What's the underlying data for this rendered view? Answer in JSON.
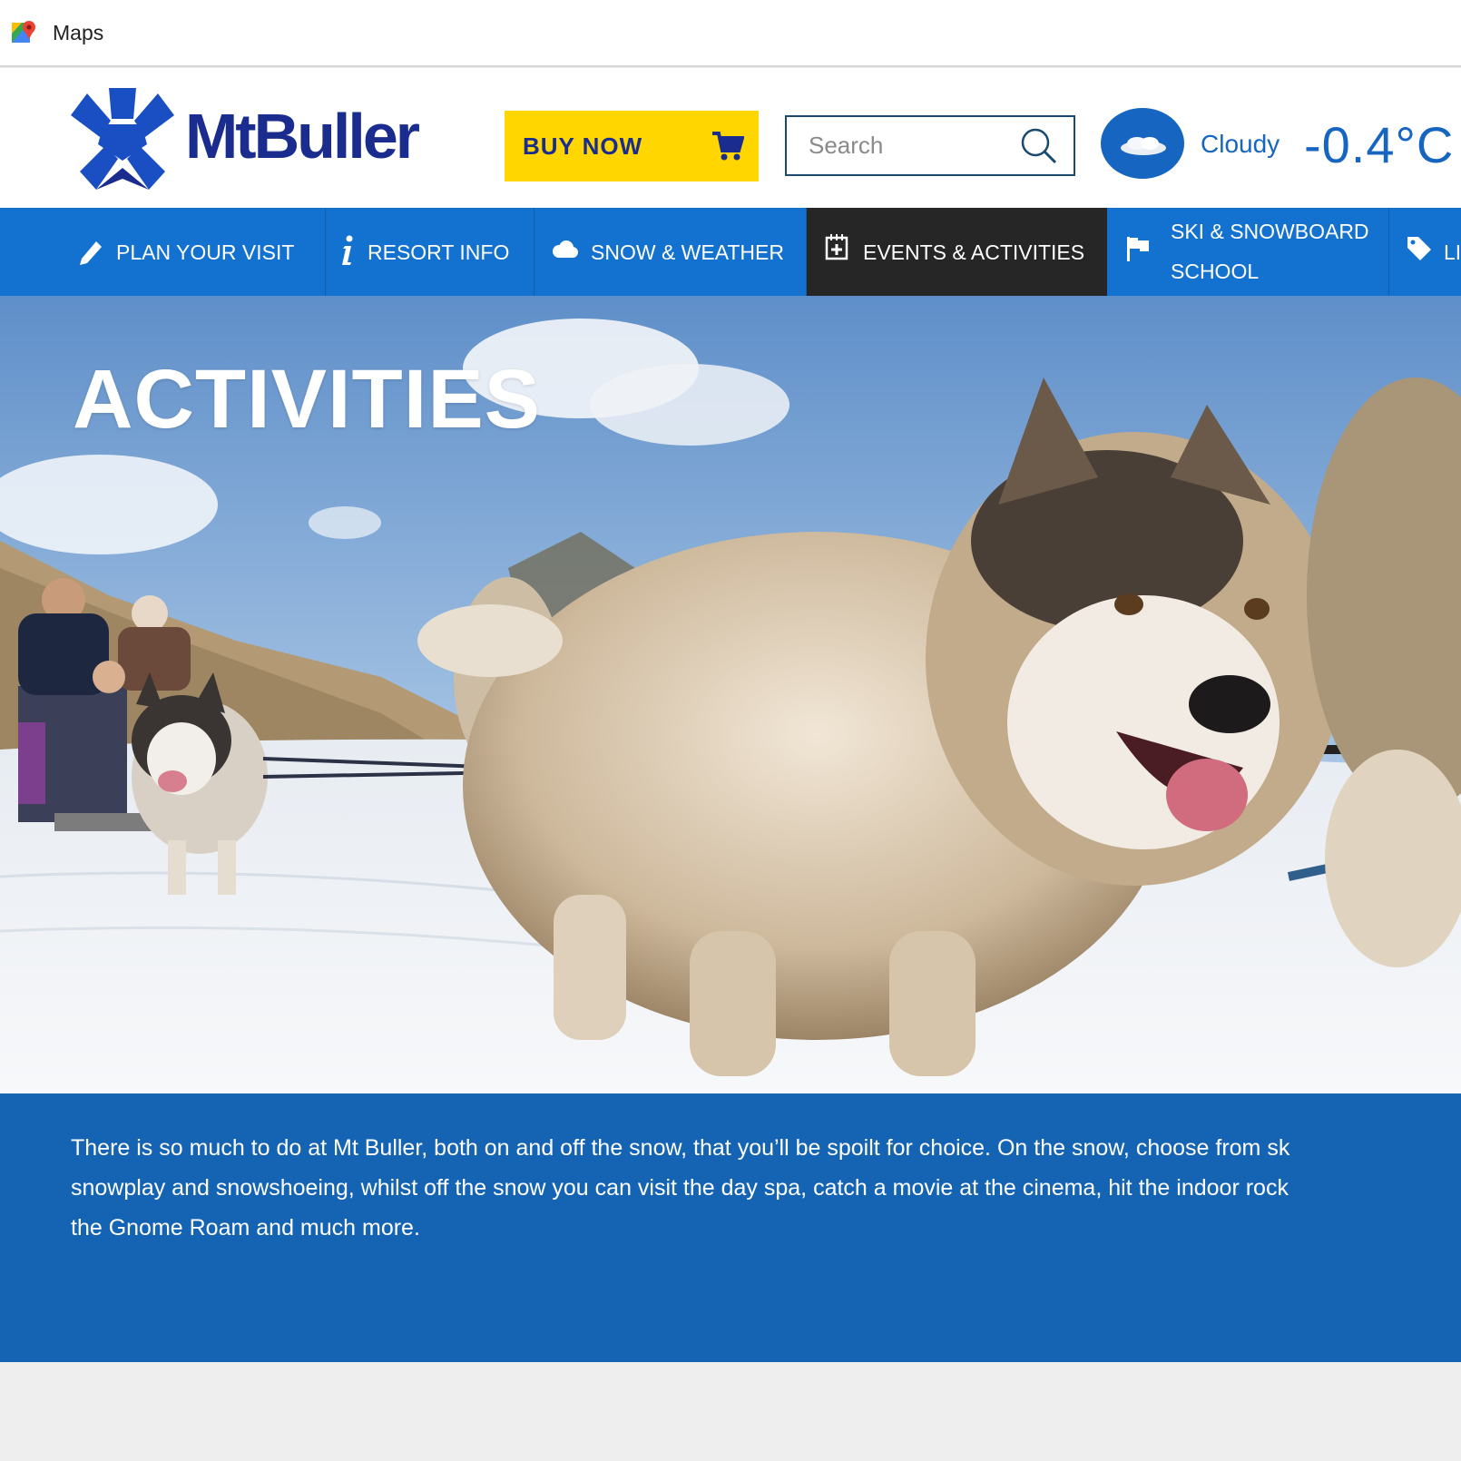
{
  "window": {
    "title": "Maps",
    "icon": "maps-pin-icon"
  },
  "header": {
    "logo_text": "MtBuller",
    "buy_now_label": "BUY NOW",
    "search_placeholder": "Search",
    "weather": {
      "condition": "Cloudy",
      "temperature": "-0.4°C"
    }
  },
  "nav": {
    "items": [
      {
        "label": "PLAN YOUR VISIT",
        "icon": "pencil-icon"
      },
      {
        "label": "RESORT INFO",
        "icon": "info-icon"
      },
      {
        "label": "SNOW & WEATHER",
        "icon": "cloud-icon"
      },
      {
        "label": "EVENTS & ACTIVITIES",
        "icon": "calendar-icon",
        "active": true
      },
      {
        "label_line1": "SKI & SNOWBOARD",
        "label_line2": "SCHOOL",
        "icon": "flag-icon"
      },
      {
        "label": "LI",
        "icon": "tag-icon"
      }
    ]
  },
  "hero": {
    "title": "ACTIVITIES"
  },
  "intro": {
    "lines": [
      "There is so much to do at Mt Buller, both on and off the snow, that you’ll be spoilt for choice. On the snow, choose from sk",
      "snowplay and snowshoeing, whilst off the snow you can visit the day spa, catch a movie at the cinema, hit the indoor rock",
      "the Gnome Roam and much more."
    ]
  },
  "colors": {
    "brand_blue": "#1371cf",
    "navy": "#1a2d8f",
    "yellow": "#ffd600",
    "active_nav": "#262626",
    "intro_bg": "#1564b4"
  }
}
